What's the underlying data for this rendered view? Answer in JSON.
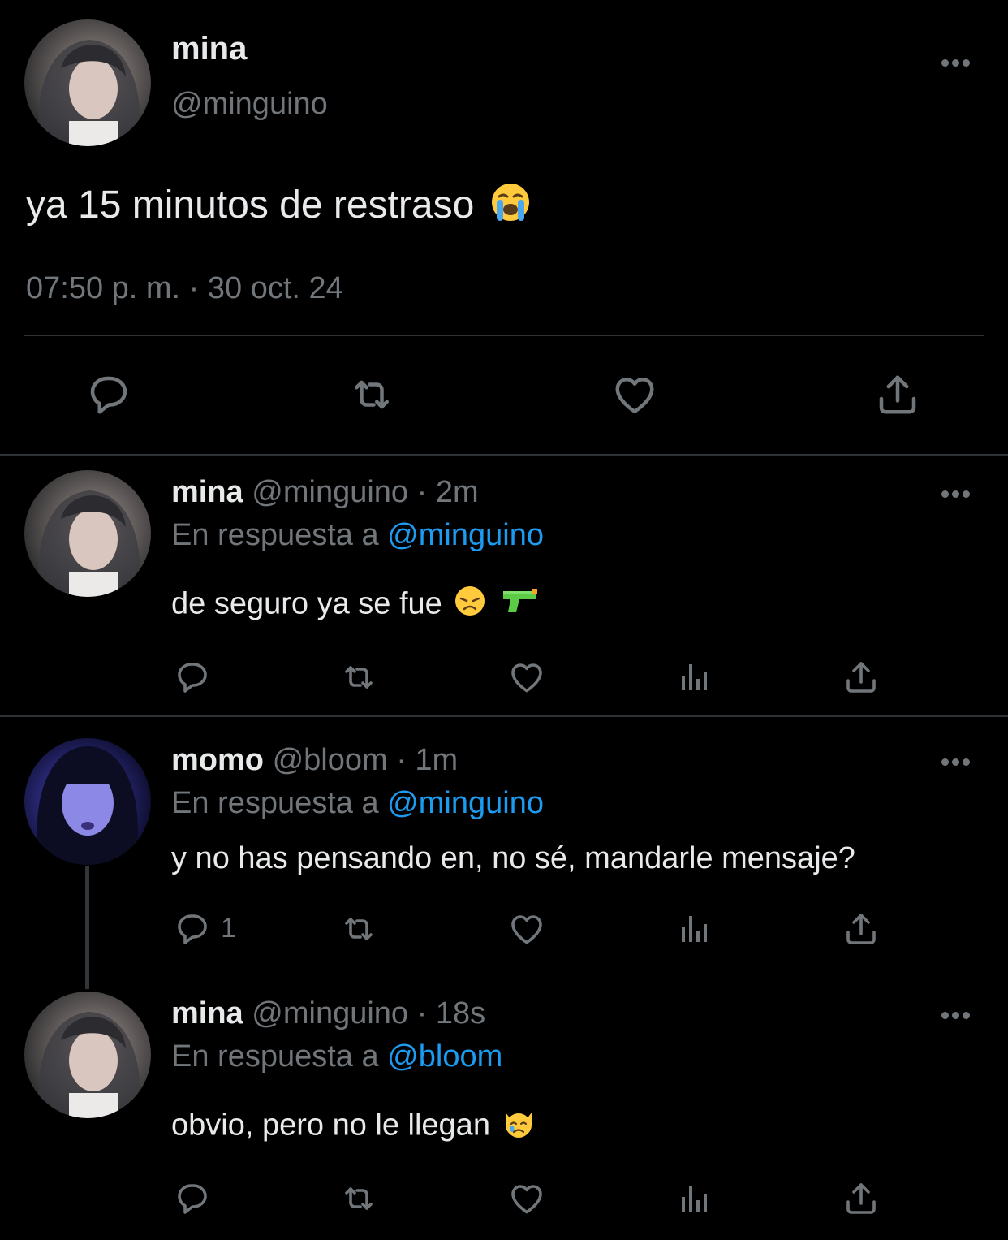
{
  "main_tweet": {
    "name": "mina",
    "handle": "@minguino",
    "text": "ya 15 minutos de restraso",
    "emoji": "loudly-crying-face",
    "timestamp": "07:50 p. m. · 30 oct. 24"
  },
  "replies": [
    {
      "name": "mina",
      "handle": "@minguino",
      "time": "· 2m",
      "reply_prefix": "En respuesta a",
      "reply_to": "@minguino",
      "text": "de seguro ya se fue",
      "emojis": [
        "disappointed-face",
        "water-pistol"
      ],
      "reply_count": ""
    },
    {
      "name": "momo",
      "handle": "@bloom",
      "time": "· 1m",
      "reply_prefix": "En respuesta a",
      "reply_to": "@minguino",
      "text": "y no has pensando en, no sé, mandarle mensaje?",
      "emojis": [],
      "reply_count": "1"
    },
    {
      "name": "mina",
      "handle": "@minguino",
      "time": "· 18s",
      "reply_prefix": "En respuesta a",
      "reply_to": "@bloom",
      "text": "obvio, pero no le llegan",
      "emojis": [
        "crying-cat-face"
      ],
      "reply_count": ""
    }
  ],
  "colors": {
    "background": "#000000",
    "text": "#e7e9ea",
    "secondary": "#71767b",
    "link": "#1d9bf0",
    "divider": "#2f3336"
  },
  "icons": [
    "reply-icon",
    "retweet-icon",
    "like-icon",
    "views-icon",
    "share-icon",
    "more-icon"
  ]
}
